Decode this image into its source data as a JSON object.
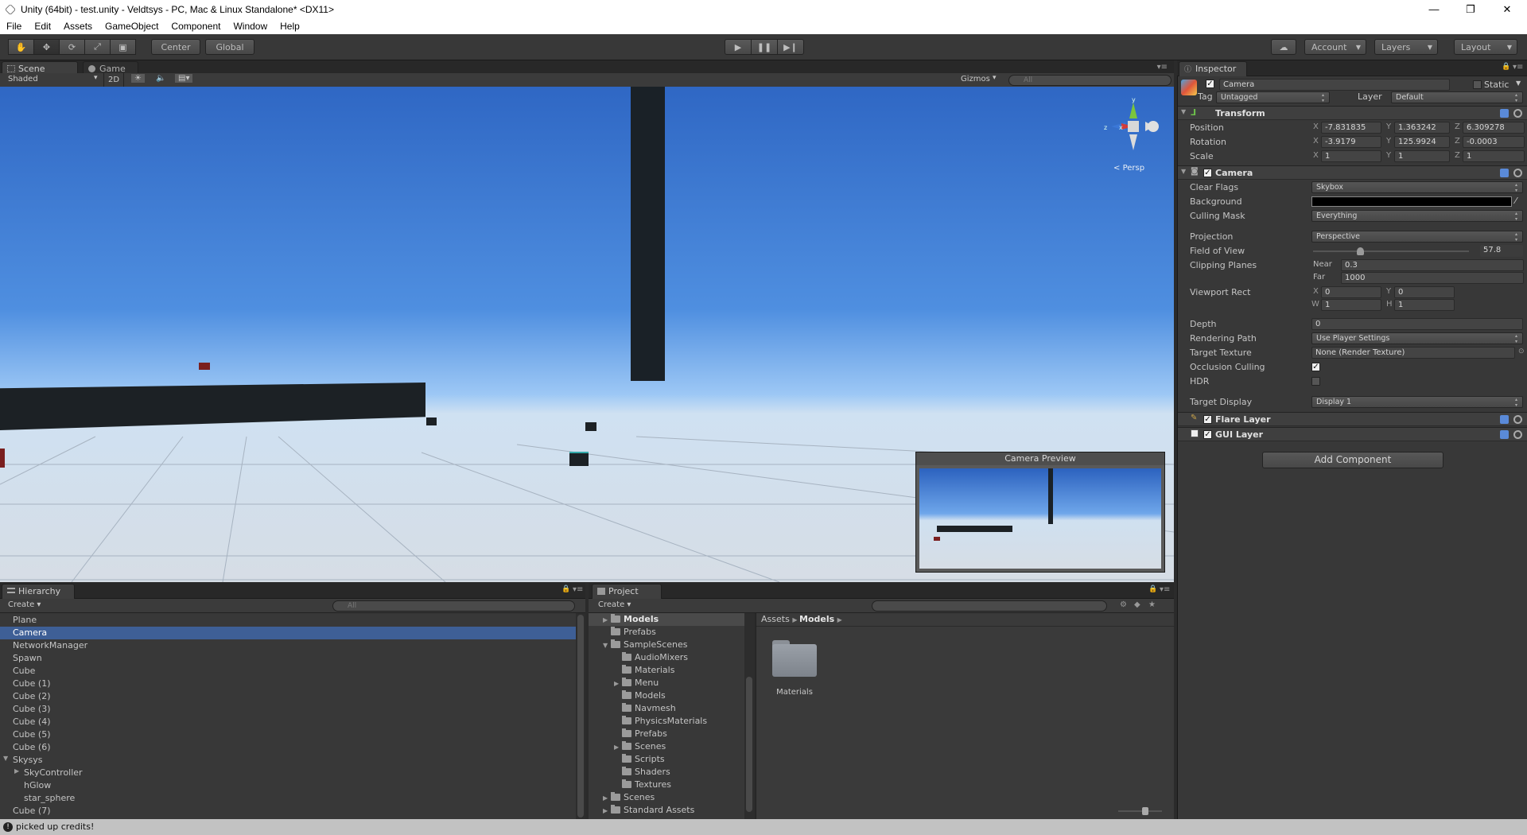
{
  "window": {
    "title": "Unity (64bit) - test.unity - Veldtsys - PC, Mac & Linux Standalone* <DX11>"
  },
  "menu": [
    "File",
    "Edit",
    "Assets",
    "GameObject",
    "Component",
    "Window",
    "Help"
  ],
  "toolbar": {
    "pivot": "Center",
    "space": "Global",
    "account": "Account",
    "layers": "Layers",
    "layout": "Layout"
  },
  "scene": {
    "tab_scene": "Scene",
    "tab_game": "Game",
    "shading": "Shaded",
    "mode_2d": "2D",
    "gizmos": "Gizmos",
    "search_placeholder": "All",
    "persp_label": "Persp",
    "gizmo_x": "x",
    "gizmo_y": "y",
    "gizmo_z": "z",
    "preview_title": "Camera Preview"
  },
  "hierarchy": {
    "tab": "Hierarchy",
    "create": "Create",
    "search_placeholder": "All",
    "items": [
      "Plane",
      "Camera",
      "NetworkManager",
      "Spawn",
      "Cube",
      "Cube (1)",
      "Cube (2)",
      "Cube (3)",
      "Cube (4)",
      "Cube (5)",
      "Cube (6)",
      "Skysys",
      "SkyController",
      "hGlow",
      "star_sphere",
      "Cube (7)"
    ]
  },
  "project": {
    "tab": "Project",
    "create": "Create",
    "tree": [
      "Models",
      "Prefabs",
      "SampleScenes",
      "AudioMixers",
      "Materials",
      "Menu",
      "Models",
      "Navmesh",
      "PhysicsMaterials",
      "Prefabs",
      "Scenes",
      "Scripts",
      "Shaders",
      "Textures",
      "Scenes",
      "Standard Assets"
    ],
    "breadcrumb_root": "Assets",
    "breadcrumb_current": "Models",
    "asset_label": "Materials"
  },
  "inspector": {
    "tab": "Inspector",
    "object_name": "Camera",
    "static_label": "Static",
    "tag_label": "Tag",
    "tag_value": "Untagged",
    "layer_label": "Layer",
    "layer_value": "Default",
    "transform": {
      "title": "Transform",
      "position_label": "Position",
      "rotation_label": "Rotation",
      "scale_label": "Scale",
      "position": {
        "x": "-7.831835",
        "y": "1.363242",
        "z": "6.309278"
      },
      "rotation": {
        "x": "-3.9179",
        "y": "125.9924",
        "z": "-0.0003"
      },
      "scale": {
        "x": "1",
        "y": "1",
        "z": "1"
      }
    },
    "camera": {
      "title": "Camera",
      "clear_flags_label": "Clear Flags",
      "clear_flags": "Skybox",
      "background_label": "Background",
      "background_color": "#000000",
      "culling_mask_label": "Culling Mask",
      "culling_mask": "Everything",
      "projection_label": "Projection",
      "projection": "Perspective",
      "fov_label": "Field of View",
      "fov": "57.8",
      "fov_fraction": 0.3,
      "clipping_label": "Clipping Planes",
      "near_label": "Near",
      "near": "0.3",
      "far_label": "Far",
      "far": "1000",
      "viewport_label": "Viewport Rect",
      "vp_x": "0",
      "vp_y": "0",
      "vp_w": "1",
      "vp_h": "1",
      "depth_label": "Depth",
      "depth": "0",
      "rendering_path_label": "Rendering Path",
      "rendering_path": "Use Player Settings",
      "target_texture_label": "Target Texture",
      "target_texture": "None (Render Texture)",
      "occlusion_label": "Occlusion Culling",
      "occlusion": true,
      "hdr_label": "HDR",
      "hdr": false,
      "target_display_label": "Target Display",
      "target_display": "Display 1"
    },
    "flare_layer": "Flare Layer",
    "gui_layer": "GUI Layer",
    "add_component": "Add Component"
  },
  "status": {
    "message": "picked up credits!"
  }
}
